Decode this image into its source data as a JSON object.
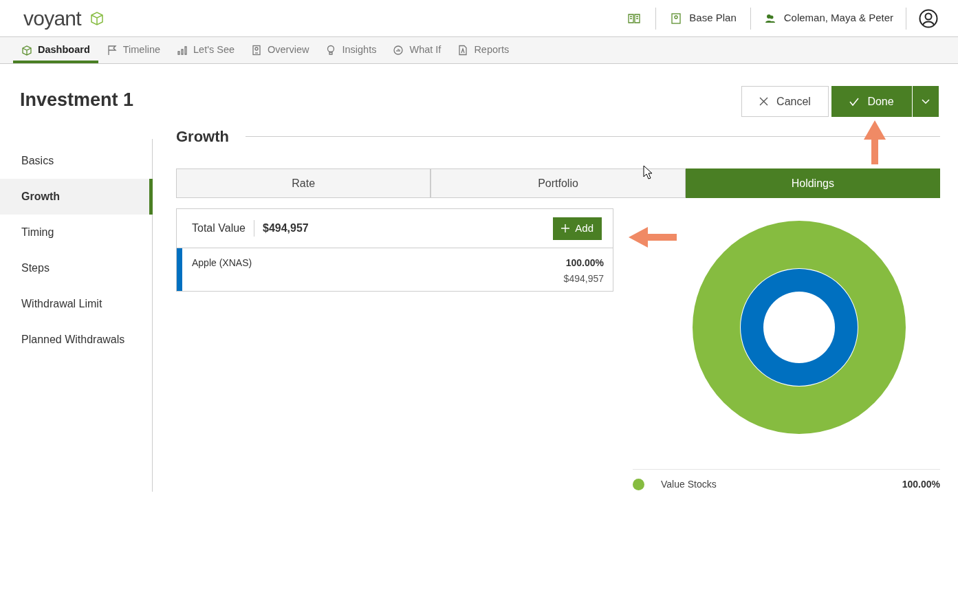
{
  "header": {
    "logo": "voyant",
    "plan": "Base Plan",
    "client": "Coleman, Maya & Peter"
  },
  "nav_tabs": [
    {
      "label": "Dashboard",
      "selected": true
    },
    {
      "label": "Timeline",
      "selected": false
    },
    {
      "label": "Let's See",
      "selected": false
    },
    {
      "label": "Overview",
      "selected": false
    },
    {
      "label": "Insights",
      "selected": false
    },
    {
      "label": "What If",
      "selected": false
    },
    {
      "label": "Reports",
      "selected": false
    }
  ],
  "page_title": "Investment 1",
  "buttons": {
    "cancel": "Cancel",
    "done": "Done"
  },
  "sidebar": {
    "items": [
      {
        "label": "Basics",
        "selected": false
      },
      {
        "label": "Growth",
        "selected": true
      },
      {
        "label": "Timing",
        "selected": false
      },
      {
        "label": "Steps",
        "selected": false
      },
      {
        "label": "Withdrawal Limit",
        "selected": false
      },
      {
        "label": "Planned Withdrawals",
        "selected": false
      }
    ]
  },
  "section_title": "Growth",
  "segment_tabs": [
    {
      "label": "Rate",
      "selected": false
    },
    {
      "label": "Portfolio",
      "selected": false
    },
    {
      "label": "Holdings",
      "selected": true
    }
  ],
  "holdings": {
    "total_label": "Total Value",
    "total_value": "$494,957",
    "add_button": "Add",
    "rows": [
      {
        "name": "Apple (XNAS)",
        "percent": "100.00%",
        "value": "$494,957",
        "color": "#0070c0"
      }
    ]
  },
  "allocation": {
    "legend": [
      {
        "label": "Value Stocks",
        "percent": "100.00%",
        "color": "#86bc40"
      }
    ]
  }
}
